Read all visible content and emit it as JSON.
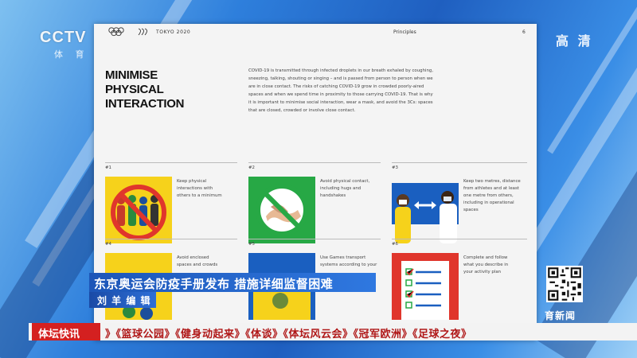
{
  "broadcast": {
    "channel_logo": "CCTV",
    "channel_sub": "体 育",
    "hd_label": "高 清",
    "headline": "东京奥运会防疫手册发布 措施详细监督困难",
    "editor": "刘 羊 编 辑",
    "ticker_label": "体坛快讯",
    "ticker_text": "》《篮球公园》《健身动起来》《体谈》《体坛风云会》《冠军欧洲》《足球之夜》",
    "news_label": "育新闻"
  },
  "document": {
    "header": {
      "event_name": "TOKYO 2020",
      "section": "Principles",
      "page_number": "6"
    },
    "heading_lines": [
      "MINIMISE",
      "PHYSICAL",
      "INTERACTION"
    ],
    "intro_lines": [
      "COVID-19 is transmitted through infected droplets in our breath exhaled by coughing,",
      "sneezing, talking, shouting or singing – and is passed from person to person when we",
      "are in close contact. The risks of catching COVID-19 grow in crowded poorly-aired",
      "spaces and when we spend time in proximity to those carrying COVID-19. That is why",
      "it is important to minimise social interaction, wear a mask, and avoid the 3Cs: spaces",
      "that are closed, crowded or involve close contact."
    ],
    "rules": [
      {
        "number": "#1",
        "caption_lines": [
          "Keep physical",
          "interactions with",
          "others to a minimum"
        ],
        "icon": "no-crowd-icon"
      },
      {
        "number": "#2",
        "caption_lines": [
          "Avoid physical contact,",
          "including hugs and",
          "handshakes"
        ],
        "icon": "no-handshake-icon"
      },
      {
        "number": "#3",
        "caption_lines": [
          "Keep two metres, distance",
          "from athletes and at least",
          "one metre from others,",
          "including in operational",
          "spaces"
        ],
        "icon": "distance-icon"
      },
      {
        "number": "#4",
        "caption_lines": [
          "Avoid enclosed",
          "spaces and crowds"
        ],
        "icon": "enclosed-space-icon"
      },
      {
        "number": "#5",
        "caption_lines": [
          "Use Games transport",
          "systems according to your"
        ],
        "icon": "transport-icon"
      },
      {
        "number": "#6",
        "caption_lines": [
          "Complete and follow",
          "what you describe in",
          "your activity plan"
        ],
        "icon": "checklist-icon"
      }
    ]
  },
  "colors": {
    "yellow": "#f6d21b",
    "green": "#27a845",
    "blue": "#1a5fc0",
    "red": "#e0362c",
    "banner_blue": "#1d56b8",
    "ticker_red": "#d42020"
  }
}
